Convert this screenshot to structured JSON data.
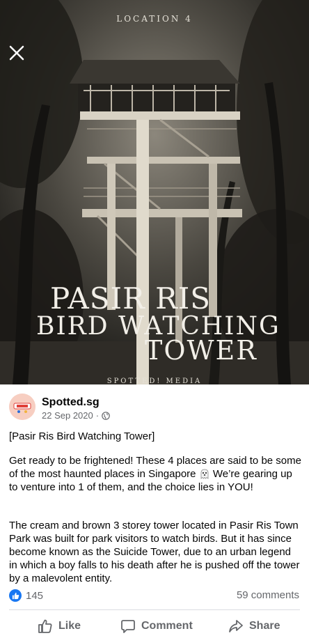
{
  "hero": {
    "location_label": "LOCATION 4",
    "title_line1": "PASIR RIS",
    "title_line2": "BIRD WATCHING",
    "title_line3": "TOWER",
    "watermark": "SPOTTED! MEDIA"
  },
  "post": {
    "author": "Spotted.sg",
    "date": "22 Sep 2020",
    "separator": "·",
    "paragraph1": "[Pasir Ris Bird Watching Tower]",
    "paragraph2_a": "Get ready to be frightened! These 4 places are said to be some of the most haunted places in Singapore",
    "paragraph2_b": "We’re gearing up to venture into 1 of them, and the choice lies in YOU!",
    "paragraph3": "The cream and brown 3 storey tower located in Pasir Ris Town Park was built for park visitors to watch birds. But it has since become known as the Suicide Tower, due to an urban legend in which a boy falls to his death after he is pushed off the tower by a malevolent entity.",
    "reaction_count": "145",
    "comment_count": "59 comments"
  },
  "actions": {
    "like": "Like",
    "comment": "Comment",
    "share": "Share"
  },
  "icons": [
    "close-icon",
    "globe-icon",
    "ghost-emoji-icon",
    "like-reaction-icon",
    "thumbs-up-icon",
    "comment-icon",
    "share-icon"
  ],
  "colors": {
    "facebook_blue": "#1877f2",
    "secondary_text": "#65676b",
    "avatar_bg": "#f7cec1"
  }
}
